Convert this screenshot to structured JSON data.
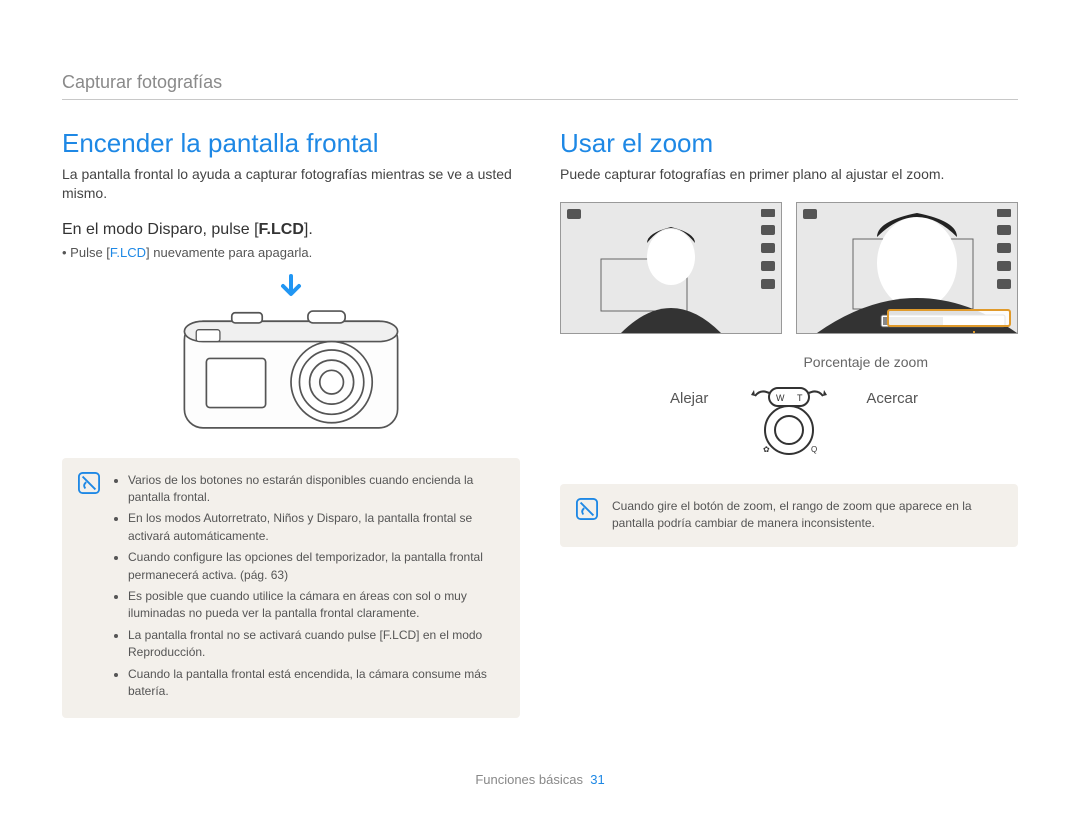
{
  "breadcrumb": "Capturar fotografías",
  "footer": {
    "section": "Funciones básicas",
    "page": "31"
  },
  "left": {
    "title": "Encender la pantalla frontal",
    "intro": "La pantalla frontal lo ayuda a capturar fotografías mientras se ve a usted mismo.",
    "step_prefix": "En el modo Disparo, pulse [",
    "step_key": "F.LCD",
    "step_suffix": "].",
    "sub_prefix": "• Pulse [",
    "sub_key": "F.LCD",
    "sub_suffix": "] nuevamente para apagarla.",
    "notes": [
      "Varios de los botones no estarán disponibles cuando encienda la pantalla frontal.",
      "En los modos Autorretrato, Niños y Disparo, la pantalla frontal se activará automáticamente.",
      "Cuando configure las opciones del temporizador, la pantalla frontal permanecerá activa. (pág. 63)",
      "Es posible que cuando utilice la cámara en áreas con sol o muy iluminadas no pueda ver la pantalla frontal claramente.",
      "La pantalla frontal no se activará cuando pulse [F.LCD] en el modo Reproducción.",
      "Cuando la pantalla frontal está encendida, la cámara consume más batería."
    ]
  },
  "right": {
    "title": "Usar el zoom",
    "intro": "Puede capturar fotografías en primer plano al ajustar el zoom.",
    "zoom_label": "Porcentaje de zoom",
    "zoom_out": "Alejar",
    "zoom_in": "Acercar",
    "note": "Cuando gire el botón de zoom, el rango de zoom que aparece en la pantalla podría cambiar de manera inconsistente."
  }
}
